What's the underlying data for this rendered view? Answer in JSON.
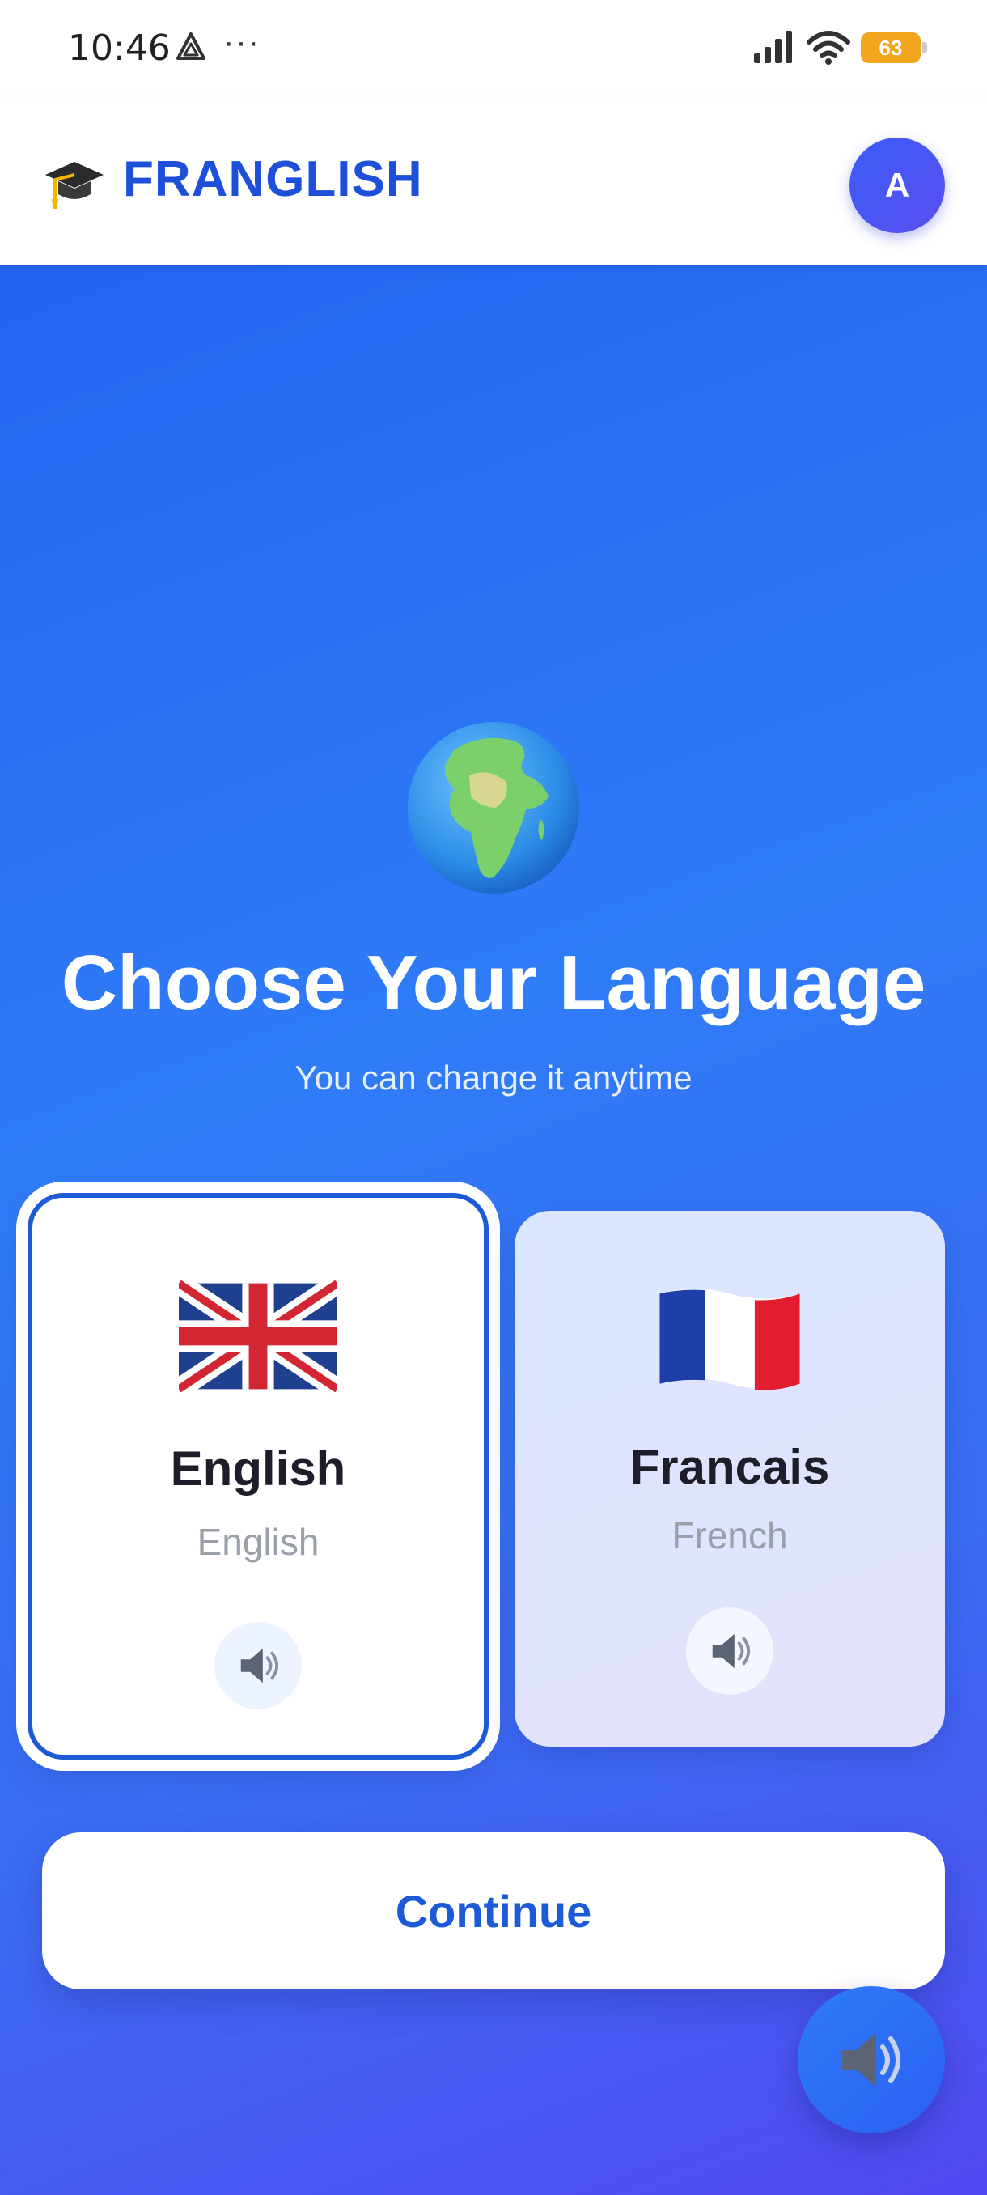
{
  "status_bar": {
    "time": "10:46",
    "more": "···",
    "battery": "63",
    "battery_color": "#f2a51f"
  },
  "header": {
    "brand_icon": "graduation-cap-icon",
    "brand_name": "FRANGLISH",
    "avatar_letter": "A",
    "brand_color": "#1d4fd8"
  },
  "main": {
    "icon": "globe-icon",
    "title": "Choose Your Language",
    "subtitle": "You can change it anytime",
    "languages": [
      {
        "name": "English",
        "subtitle": "English",
        "flag": "uk-flag-icon",
        "selected": true
      },
      {
        "name": "Francais",
        "subtitle": "French",
        "flag": "france-flag-icon",
        "selected": false
      }
    ],
    "continue_label": "Continue"
  },
  "colors": {
    "accent": "#1d5ad8",
    "gradient_start": "#2563f0",
    "gradient_end": "#5249f0"
  }
}
